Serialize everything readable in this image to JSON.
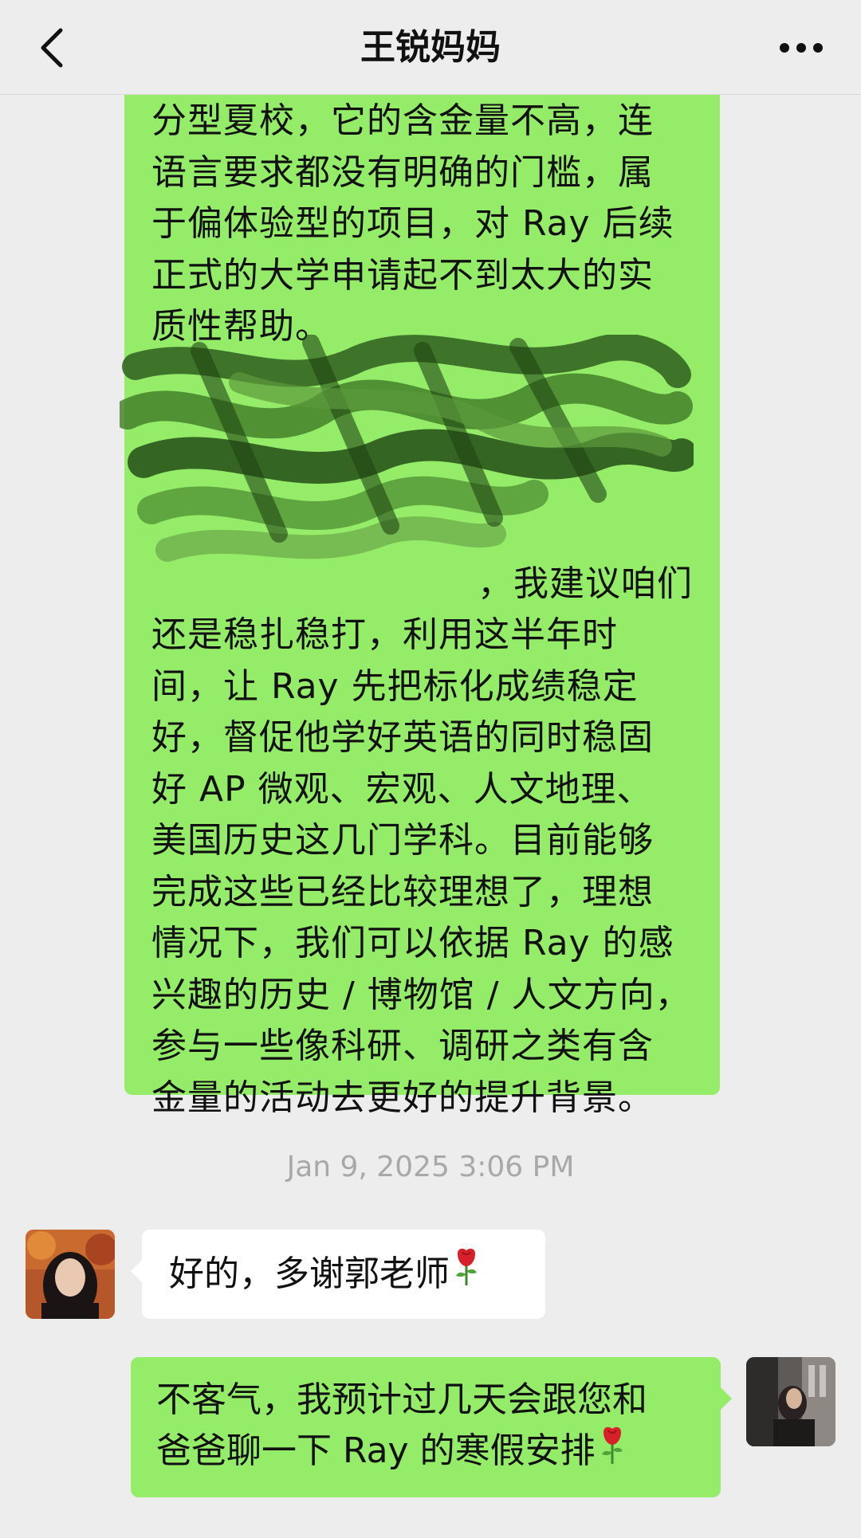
{
  "header": {
    "title": "王锐妈妈",
    "back_icon": "chevron-left-icon",
    "more_icon": "more-dots-icon"
  },
  "messages": {
    "long_block": {
      "lines_top": [
        "分型夏校，它的含金量不高，连",
        "语言要求都没有明确的门槛，属",
        "于偏体验型的项目，对 Ray 后续",
        "正式的大学申请起不到太大的实",
        "质性帮助。"
      ],
      "partial_line": "，我建议咱们",
      "lines_bottom": [
        "还是稳扎稳打，利用这半年时",
        "间，让 Ray 先把标化成绩稳定",
        "好，督促他学好英语的同时稳固",
        "好 AP 微观、宏观、人文地理、",
        "美国历史这几门学科。目前能够",
        "完成这些已经比较理想了，理想",
        "情况下，我们可以依据 Ray 的感",
        "兴趣的历史 / 博物馆 / 人文方向，",
        "参与一些像科研、调研之类有含",
        "金量的活动去更好的提升背景。"
      ]
    },
    "timestamp": "Jan 9, 2025 3:06 PM",
    "reply_left": "好的，多谢郭老师",
    "reply_right": [
      "不客气，我预计过几天会跟您和",
      "爸爸聊一下 Ray 的寒假安排"
    ]
  },
  "colors": {
    "background": "#ededed",
    "green_bubble": "#95ec69",
    "white_bubble": "#ffffff",
    "timestamp": "#a8a8a8"
  }
}
